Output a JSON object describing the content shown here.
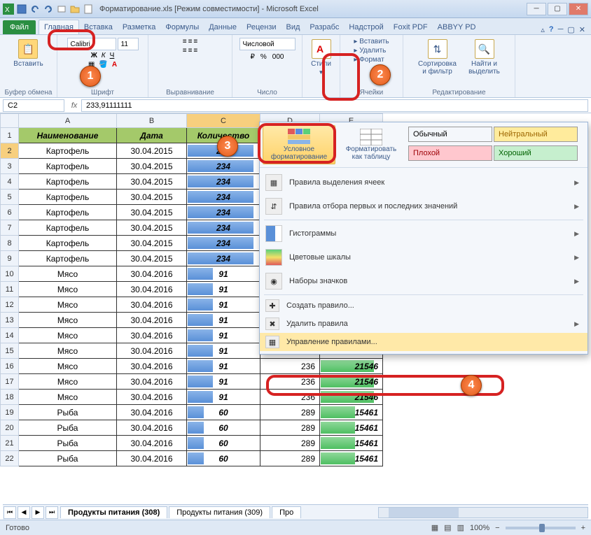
{
  "titlebar": {
    "title": "Форматирование.xls  [Режим совместимости] - Microsoft Excel"
  },
  "tabs": {
    "file": "Файл",
    "items": [
      "Главная",
      "Вставка",
      "Разметка",
      "Формулы",
      "Данные",
      "Рецензи",
      "Вид",
      "Разрабс",
      "Надстрой",
      "Foxit PDF",
      "ABBYY PD"
    ]
  },
  "ribbon": {
    "clipboard": {
      "paste": "Вставить",
      "group": "Буфер обмена"
    },
    "font": {
      "name": "Calibri",
      "size": "11",
      "group": "Шрифт"
    },
    "align": {
      "group": "Выравнивание"
    },
    "number": {
      "format": "Числовой",
      "group": "Число"
    },
    "styles": {
      "label": "Стили"
    },
    "cells": {
      "insert": "Вставить",
      "delete": "Удалить",
      "format": "Формат",
      "group": "Ячейки"
    },
    "edit": {
      "sort": "Сортировка и фильтр",
      "find": "Найти и выделить",
      "group": "Редактирование"
    }
  },
  "formula_bar": {
    "name": "C2",
    "formula": "233,91111111"
  },
  "columns": [
    "A",
    "B",
    "C",
    "D",
    "E"
  ],
  "header_row": [
    "Наименование",
    "Дата",
    "Количество",
    "",
    ""
  ],
  "chart_data": {
    "type": "table",
    "columns": [
      "row",
      "Наименование",
      "Дата",
      "Количество",
      "colD",
      "colE"
    ],
    "rows": [
      [
        2,
        "Картофель",
        "30.04.2015",
        234,
        null,
        null
      ],
      [
        3,
        "Картофель",
        "30.04.2015",
        234,
        null,
        null
      ],
      [
        4,
        "Картофель",
        "30.04.2015",
        234,
        null,
        null
      ],
      [
        5,
        "Картофель",
        "30.04.2015",
        234,
        null,
        null
      ],
      [
        6,
        "Картофель",
        "30.04.2015",
        234,
        null,
        null
      ],
      [
        7,
        "Картофель",
        "30.04.2015",
        234,
        null,
        null
      ],
      [
        8,
        "Картофель",
        "30.04.2015",
        234,
        null,
        null
      ],
      [
        9,
        "Картофель",
        "30.04.2015",
        234,
        null,
        null
      ],
      [
        10,
        "Мясо",
        "30.04.2016",
        91,
        null,
        null
      ],
      [
        11,
        "Мясо",
        "30.04.2016",
        91,
        null,
        null
      ],
      [
        12,
        "Мясо",
        "30.04.2016",
        91,
        null,
        null
      ],
      [
        13,
        "Мясо",
        "30.04.2016",
        91,
        null,
        null
      ],
      [
        14,
        "Мясо",
        "30.04.2016",
        91,
        null,
        null
      ],
      [
        15,
        "Мясо",
        "30.04.2016",
        91,
        null,
        null
      ],
      [
        16,
        "Мясо",
        "30.04.2016",
        91,
        236,
        21546
      ],
      [
        17,
        "Мясо",
        "30.04.2016",
        91,
        236,
        21546
      ],
      [
        18,
        "Мясо",
        "30.04.2016",
        91,
        236,
        21546
      ],
      [
        19,
        "Рыба",
        "30.04.2016",
        60,
        289,
        15461
      ],
      [
        20,
        "Рыба",
        "30.04.2016",
        60,
        289,
        15461
      ],
      [
        21,
        "Рыба",
        "30.04.2016",
        60,
        289,
        15461
      ],
      [
        22,
        "Рыба",
        "30.04.2016",
        60,
        289,
        15461
      ]
    ]
  },
  "sheet_tabs": [
    "Продукты питания (308)",
    "Продукты питания (309)",
    "Про"
  ],
  "statusbar": {
    "ready": "Готово",
    "zoom": "100%"
  },
  "styles_popup": {
    "cond_fmt": "Условное форматирование",
    "fmt_table": "Форматировать как таблицу",
    "gallery": {
      "normal": "Обычный",
      "neutral": "Нейтральный",
      "bad": "Плохой",
      "good": "Хороший"
    },
    "menu": {
      "highlight": "Правила выделения ячеек",
      "toprules": "Правила отбора первых и последних значений",
      "databars": "Гистограммы",
      "colorscales": "Цветовые шкалы",
      "iconsets": "Наборы значков",
      "newrule": "Создать правило...",
      "clear": "Удалить правила",
      "manage": "Управление правилами..."
    }
  },
  "badges": {
    "b1": "1",
    "b2": "2",
    "b3": "3",
    "b4": "4"
  }
}
